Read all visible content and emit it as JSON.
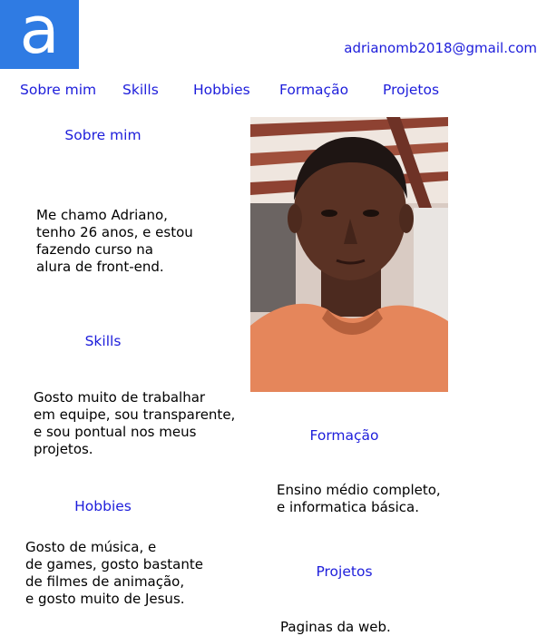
{
  "header": {
    "logo_letter": "a",
    "email": "adrianomb2018@gmail.com",
    "brand_color": "#2f7be3",
    "link_color": "#1d1ddb"
  },
  "nav": {
    "items": [
      {
        "label": "Sobre mim"
      },
      {
        "label": "Skills"
      },
      {
        "label": "Hobbies"
      },
      {
        "label": "Formação"
      },
      {
        "label": "Projetos"
      }
    ]
  },
  "about": {
    "title": "Sobre mim",
    "text": "Me chamo Adriano,\ntenho 26 anos, e estou\nfazendo curso na\nalura de front-end."
  },
  "skills": {
    "title": "Skills",
    "text": "Gosto muito de trabalhar\nem equipe, sou transparente,\ne sou pontual nos meus\nprojetos."
  },
  "hobbies": {
    "title": "Hobbies",
    "text": "Gosto de música, e\nde games, gosto bastante\nde filmes de animação,\ne  gosto muito de Jesus."
  },
  "education": {
    "title": "Formação",
    "text": "Ensino médio  completo,\ne informatica básica."
  },
  "projects": {
    "title": "Projetos",
    "text": "Paginas da web."
  },
  "photo": {
    "icon": "profile-photo"
  }
}
